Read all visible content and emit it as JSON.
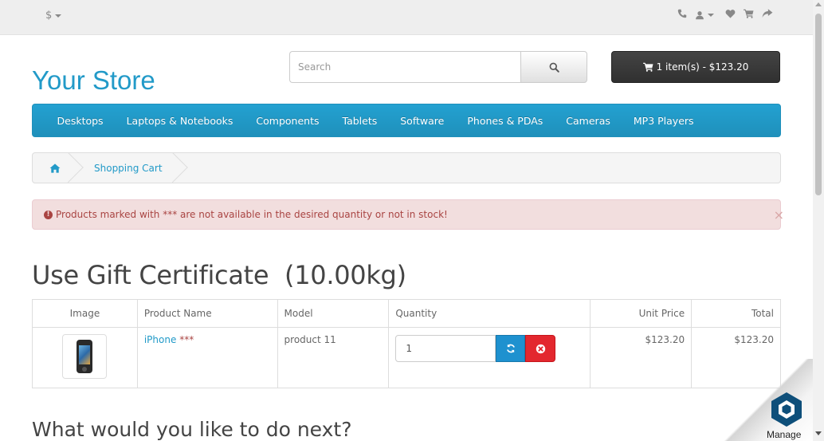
{
  "topbar": {
    "currency_symbol": "$",
    "icons": [
      "phone-icon",
      "user-icon",
      "heart-icon",
      "cart-icon",
      "share-icon"
    ]
  },
  "header": {
    "logo": "Your Store",
    "search": {
      "placeholder": "Search"
    },
    "cart_button": "1 item(s) - $123.20"
  },
  "menu": {
    "items": [
      "Desktops",
      "Laptops & Notebooks",
      "Components",
      "Tablets",
      "Software",
      "Phones & PDAs",
      "Cameras",
      "MP3 Players"
    ]
  },
  "breadcrumb": {
    "current": "Shopping Cart"
  },
  "alert": {
    "message": "Products marked with *** are not available in the desired quantity or not in stock!",
    "close": "×"
  },
  "page": {
    "title": "Use Gift Certificate  (10.00kg)"
  },
  "cart_table": {
    "headers": {
      "image": "Image",
      "name": "Product Name",
      "model": "Model",
      "quantity": "Quantity",
      "unit_price": "Unit Price",
      "total": "Total"
    },
    "rows": [
      {
        "name": "iPhone",
        "stock_flag": "***",
        "model": "product 11",
        "quantity": "1",
        "unit_price": "$123.20",
        "total": "$123.20"
      }
    ]
  },
  "next": {
    "title": "What would you like to do next?"
  },
  "manage_widget": {
    "label": "Manage"
  },
  "colors": {
    "accent": "#229ac8",
    "menu": "#229ac8",
    "alert_bg": "#f2dede",
    "alert_text": "#a94442",
    "update_button": "#1e91cf",
    "remove_button": "#e3272e",
    "cart_button": "#363636"
  }
}
